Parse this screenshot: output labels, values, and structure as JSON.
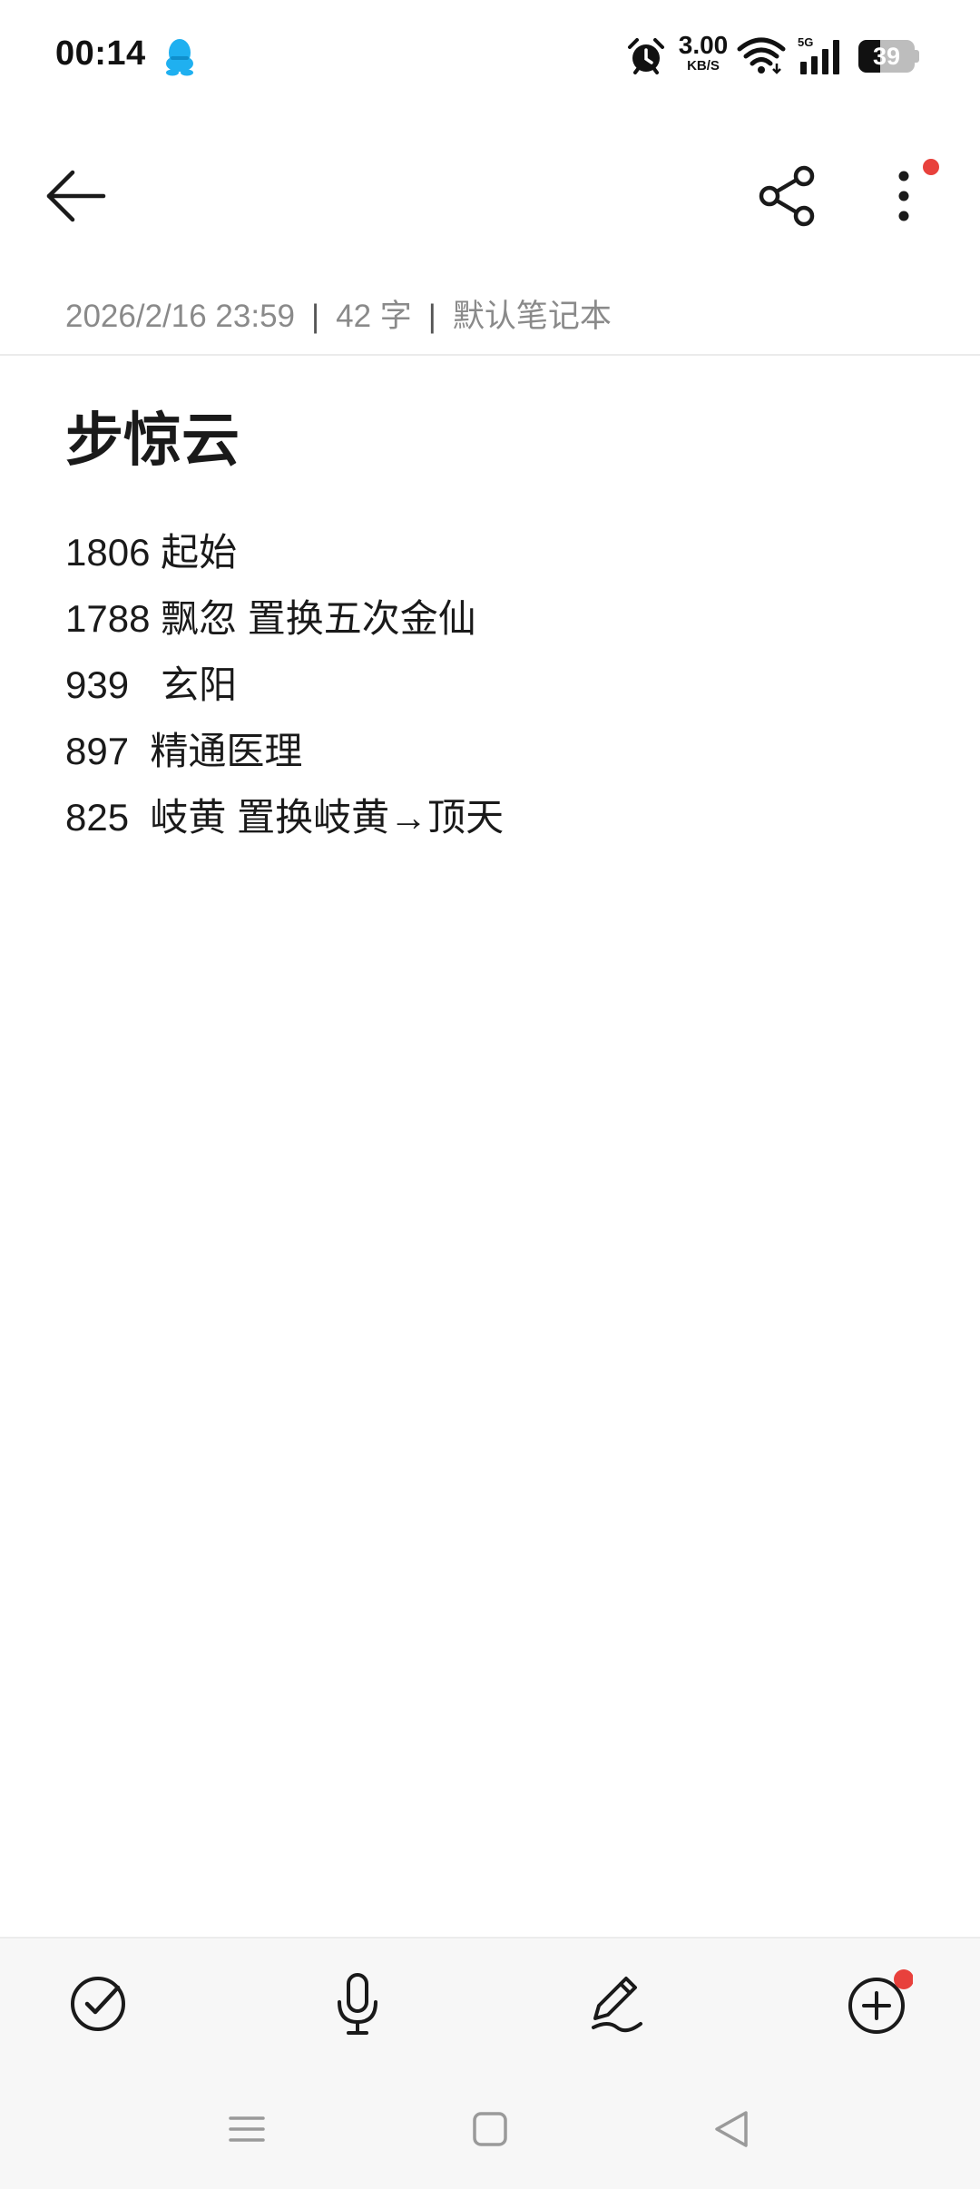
{
  "status_bar": {
    "time": "00:14",
    "net_speed_value": "3.00",
    "net_speed_unit": "KB/S",
    "network_type": "5G",
    "battery_level": "39",
    "icons": [
      "qq-icon",
      "alarm-icon",
      "wifi-icon",
      "cellular-signal-icon",
      "battery-icon"
    ]
  },
  "toolbar": {
    "icons": [
      "back-arrow-icon",
      "share-icon",
      "more-vertical-icon"
    ],
    "more_has_badge": true
  },
  "meta": {
    "datetime": "2026/2/16 23:59",
    "word_count": "42 字",
    "notebook": "默认笔记本"
  },
  "note": {
    "title": "步惊云",
    "lines": [
      "1806 起始",
      "1788 飘忽 置换五次金仙",
      "939   玄阳",
      "897  精通医理",
      "825  岐黄 置换岐黄→顶天"
    ]
  },
  "bottom_toolbar": {
    "icons": [
      "checklist-icon",
      "microphone-icon",
      "pen-icon",
      "add-circle-icon"
    ],
    "add_has_badge": true
  },
  "nav_bar": {
    "icons": [
      "menu-icon",
      "home-icon",
      "back-triangle-icon"
    ]
  },
  "colors": {
    "badge": "#e8413c",
    "qq_blue": "#1fb0f0",
    "meta_text": "#8a8a8a",
    "bottom_bar_bg": "#f7f7f7"
  }
}
